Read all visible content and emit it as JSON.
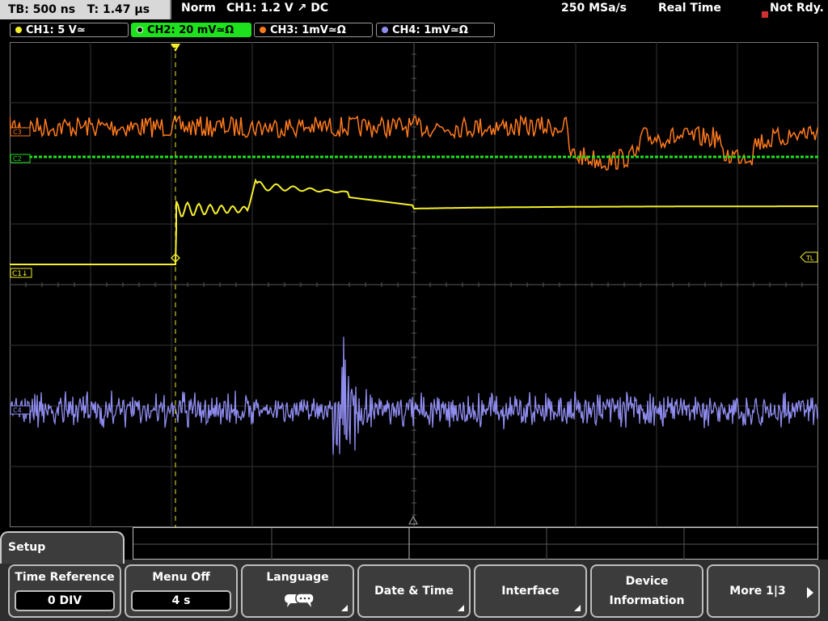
{
  "status": {
    "timebase": "TB: 500 ns",
    "trigger_time": "T: 1.47 µs",
    "mode": "Norm",
    "trigger": "CH1: 1.2 V ↗ DC",
    "sample_rate": "250 MSa/s",
    "acq_mode": "Real Time",
    "state": "Not Rdy."
  },
  "channels": [
    {
      "label": "CH1: 5 V≃",
      "color": "#f5f02a"
    },
    {
      "label": "CH2: 20 mV≃Ω",
      "color": "#1ee21e"
    },
    {
      "label": "CH3: 1mV≃Ω",
      "color": "#ff7a1c"
    },
    {
      "label": "CH4: 1mV≃Ω",
      "color": "#8f8cf0"
    }
  ],
  "markers": {
    "ch1": "C1↓",
    "ch2": "C2",
    "ch3": "C3",
    "ch4": "C4",
    "trigger_level": "TL",
    "trigger_pos": "T"
  },
  "menu": {
    "title": "Setup",
    "keys": {
      "time_reference": {
        "label": "Time Reference",
        "value": "0 DIV"
      },
      "menu_off": {
        "label": "Menu Off",
        "value": "4 s"
      },
      "language": {
        "label": "Language"
      },
      "date_time": {
        "label": "Date & Time"
      },
      "interface": {
        "label": "Interface"
      },
      "device_info": {
        "label1": "Device",
        "label2": "Information"
      },
      "more": {
        "label": "More 1|3"
      }
    }
  }
}
